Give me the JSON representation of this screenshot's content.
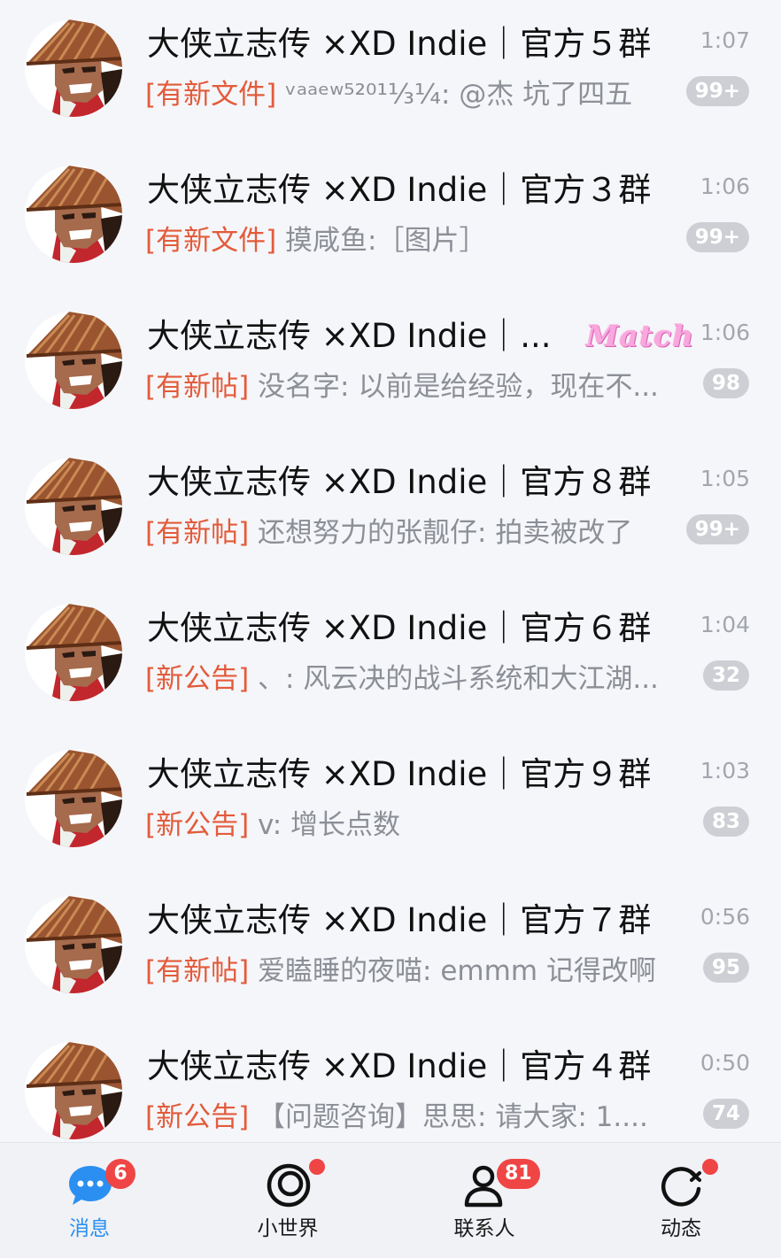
{
  "chats": [
    {
      "title": "大侠立志传 ×XD Indie｜官方５群",
      "time": "1:07",
      "tag": "[有新文件]",
      "message": " ᵛᵃᵃᵉʷ⁵²⁰¹⅓¼: @杰 坑了四五",
      "badge": "99+"
    },
    {
      "title": "大侠立志传 ×XD Indie｜官方３群",
      "time": "1:06",
      "tag": "[有新文件]",
      "message": " 摸咸鱼:［图片］",
      "badge": "99+"
    },
    {
      "title": "大侠立志传 ×XD Indie｜...",
      "time": "1:06",
      "tag": "[有新帖]",
      "message": " 没名字: 以前是给经验，现在不...",
      "badge": "98",
      "sticker": "Match"
    },
    {
      "title": "大侠立志传 ×XD Indie｜官方８群",
      "time": "1:05",
      "tag": "[有新帖]",
      "message": " 还想努力的张靓仔: 拍卖被改了",
      "badge": "99+"
    },
    {
      "title": "大侠立志传 ×XD Indie｜官方６群",
      "time": "1:04",
      "tag": "[新公告]",
      "message": " 、: 风云决的战斗系统和大江湖...",
      "badge": "32"
    },
    {
      "title": "大侠立志传 ×XD Indie｜官方９群",
      "time": "1:03",
      "tag": "[新公告]",
      "message": " v: 增长点数",
      "badge": "83"
    },
    {
      "title": "大侠立志传 ×XD Indie｜官方７群",
      "time": "0:56",
      "tag": "[有新帖]",
      "message": " 爱瞌睡的夜喵: emmm 记得改啊",
      "badge": "95"
    },
    {
      "title": "大侠立志传 ×XD Indie｜官方４群",
      "time": "0:50",
      "tag": "[新公告]",
      "message": " 【问题咨询】思思: 请大家:  1....",
      "badge": "74"
    }
  ],
  "tabbar": {
    "messages": {
      "label": "消息",
      "badge": "6",
      "icon": "chat-bubble-icon"
    },
    "world": {
      "label": "小世界",
      "icon": "small-world-icon"
    },
    "contacts": {
      "label": "联系人",
      "badge": "81",
      "icon": "contacts-icon"
    },
    "moments": {
      "label": "动态",
      "icon": "moments-icon"
    }
  },
  "colors": {
    "accent": "#2a8ff0",
    "tag_red": "#e35b3b",
    "badge_grey": "#cdcfd4",
    "badge_red": "#f04545"
  }
}
